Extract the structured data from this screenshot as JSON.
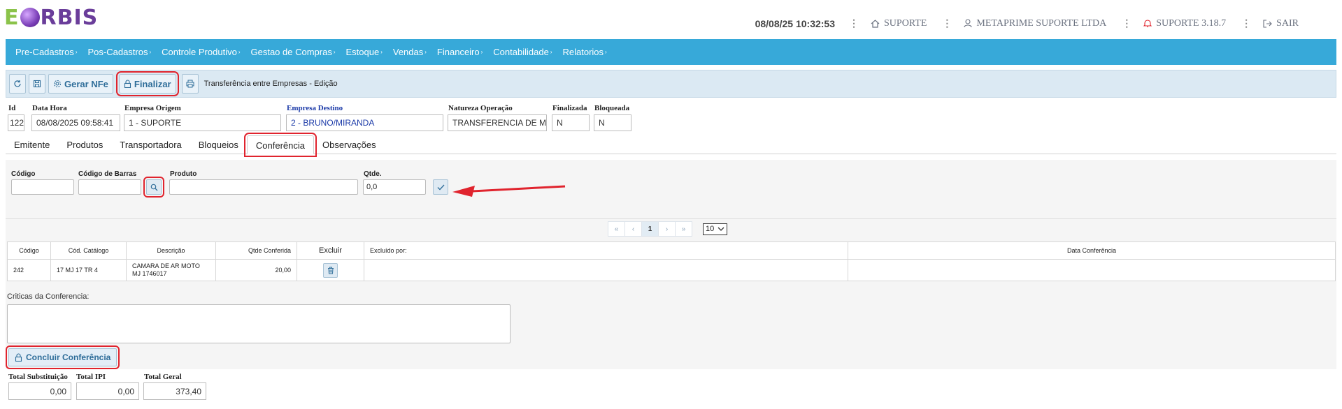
{
  "header": {
    "logo_e": "E",
    "logo_rest": "RBIS",
    "datetime": "08/08/25 10:32:53",
    "home_label": "SUPORTE",
    "user_label": "METAPRIME SUPORTE LTDA",
    "version_label": "SUPORTE 3.18.7",
    "exit_label": "SAIR"
  },
  "menu": [
    "Pre-Cadastros",
    "Pos-Cadastros",
    "Controle Produtivo",
    "Gestao de Compras",
    "Estoque",
    "Vendas",
    "Financeiro",
    "Contabilidade",
    "Relatorios"
  ],
  "toolbar": {
    "gerar_nfe": "Gerar NFe",
    "finalizar": "Finalizar",
    "title": "Transferência entre Empresas - Edição"
  },
  "form": {
    "id_label": "Id",
    "id_value": "122",
    "datahora_label": "Data Hora",
    "datahora_value": "08/08/2025 09:58:41",
    "origem_label": "Empresa Origem",
    "origem_value": "1 - SUPORTE",
    "destino_label": "Empresa Destino",
    "destino_value": "2 - BRUNO/MIRANDA",
    "natureza_label": "Natureza Operação",
    "natureza_value": "TRANSFERENCIA DE MERC",
    "finalizada_label": "Finalizada",
    "finalizada_value": "N",
    "bloqueada_label": "Bloqueada",
    "bloqueada_value": "N"
  },
  "tabs": [
    "Emitente",
    "Produtos",
    "Transportadora",
    "Bloqueios",
    "Conferência",
    "Observações"
  ],
  "conferencia": {
    "codigo_label": "Código",
    "codigo_barras_label": "Código de Barras",
    "produto_label": "Produto",
    "qtde_label": "Qtde.",
    "qtde_value": "0,0"
  },
  "pager": {
    "first": "«",
    "prev": "‹",
    "current": "1",
    "next": "›",
    "last": "»",
    "page_size": "10"
  },
  "table": {
    "headers": [
      "Código",
      "Cód. Catálogo",
      "Descrição",
      "Qtde Conferida",
      "Excluir",
      "Excluído por:",
      "Data Conferência"
    ],
    "rows": [
      {
        "codigo": "242",
        "catalogo": "17 MJ 17 TR 4",
        "descricao": "CAMARA DE AR MOTO MJ 1746017",
        "qtde": "20,00",
        "excluido_por": "",
        "data": ""
      }
    ]
  },
  "criticas_label": "Criticas da Conferencia:",
  "concluir_label": "Concluir Conferência",
  "totais": {
    "subst_label": "Total Substituição",
    "subst_value": "0,00",
    "ipi_label": "Total IPI",
    "ipi_value": "0,00",
    "geral_label": "Total Geral",
    "geral_value": "373,40"
  },
  "colors": {
    "menubar": "#37a9d9",
    "toolbar": "#dbe9f3",
    "highlight": "#e0242e",
    "arrow": "#e0242e"
  },
  "icons": [
    "refresh-icon",
    "save-icon",
    "gear-icon",
    "lock-icon",
    "printer-icon",
    "search-icon",
    "check-icon",
    "trash-icon",
    "home-icon",
    "user-icon",
    "bell-icon",
    "logout-icon"
  ]
}
